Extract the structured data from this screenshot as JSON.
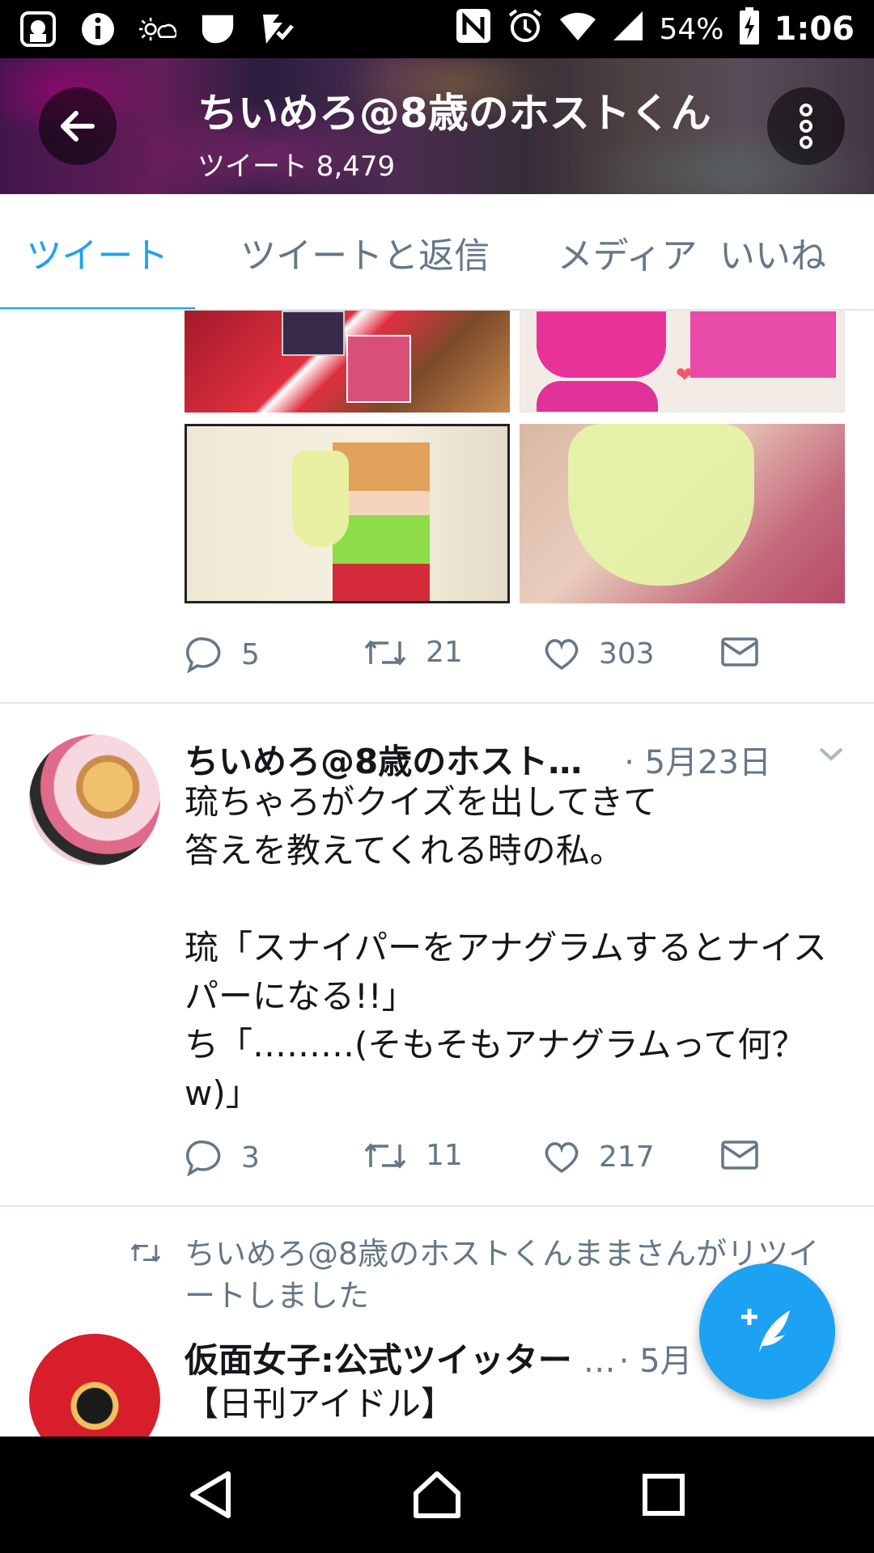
{
  "status_bar": {
    "battery": "54%",
    "time": "1:06",
    "icons": [
      "app-notification-icon",
      "info-icon",
      "weather-icon",
      "shield-icon",
      "check-task-icon",
      "nfc-icon",
      "alarm-icon",
      "wifi-icon",
      "signal-icon",
      "battery-charging-icon"
    ]
  },
  "header": {
    "name": "ちいめろ@8歳のホストくん",
    "tweet_count": "ツイート 8,479",
    "back_icon": "arrow-left-icon",
    "more_icon": "more-vertical-icon"
  },
  "tabs": [
    {
      "label": "ツイート",
      "active": true
    },
    {
      "label": "ツイートと返信",
      "active": false
    },
    {
      "label": "メディア",
      "active": false
    },
    {
      "label": "いいね",
      "active": false
    }
  ],
  "tweet1": {
    "reply_count": "5",
    "retweet_count": "21",
    "like_count": "303"
  },
  "tweet2": {
    "author": "ちいめろ@8歳のホスト…",
    "date": "· 5月23日",
    "body": "琉ちゃろがクイズを出してきて\n答えを教えてくれる時の私。\n\n琉「スナイパーをアナグラムするとナイスパーになる!!」\nち「………(そもそもアナグラムって何？w)」",
    "reply_count": "3",
    "retweet_count": "11",
    "like_count": "217"
  },
  "tweet3": {
    "retweet_notice": "ちいめろ@8歳のホストくんままさんがリツイートしました",
    "author": "仮面女子:公式ツイッター",
    "ellipsis": "…",
    "date": "· 5月",
    "body": "【日刊アイドル】"
  },
  "colors": {
    "accent": "#1da1f2",
    "secondary_text": "#657786",
    "divider": "#e1e8ed"
  }
}
